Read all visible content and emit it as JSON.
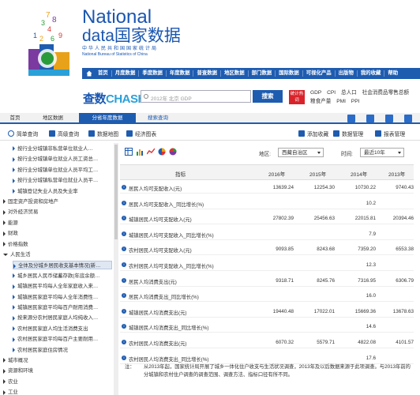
{
  "brand": {
    "line1": "National",
    "line2": "data国家数据",
    "line3": "中华人民共和国国家统计局",
    "line4": "National Bureau of Statistics of China"
  },
  "topnav": [
    "首页",
    "月度数据",
    "季度数据",
    "年度数据",
    "普查数据",
    "地区数据",
    "部门数据",
    "国际数据",
    "可视化产品",
    "出版物",
    "我的收藏",
    "帮助"
  ],
  "search": {
    "brand_main": "查数",
    "brand_sub": "CHASHU",
    "placeholder": "2012年 北京 GDP",
    "button": "搜索",
    "hot_badge": "统计热词",
    "hot_links": [
      "GDP",
      "CPI",
      "总人口",
      "社会消费品零售总额",
      "粮食产量",
      "PMI",
      "PPI"
    ]
  },
  "tabs": [
    "首页",
    "地区数据",
    "分省年度数据",
    "搜索查询"
  ],
  "toolbar": {
    "simple_query": "简单查询",
    "advanced_query": "高级查询",
    "data_map": "数据地图",
    "economic_chart": "经济图表",
    "add_favorite": "添加收藏",
    "data_manage": "数据管理",
    "report_manage": "报表管理"
  },
  "sidebar": [
    {
      "label": "按行业分城镇非私营单位就业人…",
      "level": 2,
      "arrow": "right"
    },
    {
      "label": "按行业分城镇单位就业人员工资总…",
      "level": 2,
      "arrow": "right"
    },
    {
      "label": "按行业分城镇单位就业人员平均工…",
      "level": 2,
      "arrow": "right"
    },
    {
      "label": "按行业分城镇私营单位就业人员平…",
      "level": 2,
      "arrow": "right"
    },
    {
      "label": "城镇登记失业人员及失业率",
      "level": 2,
      "arrow": "right"
    },
    {
      "label": "固定资产投资和房地产",
      "level": 1,
      "arrow": "right"
    },
    {
      "label": "对外经济贸易",
      "level": 1,
      "arrow": "right"
    },
    {
      "label": "能源",
      "level": 1,
      "arrow": "right"
    },
    {
      "label": "财政",
      "level": 1,
      "arrow": "right"
    },
    {
      "label": "价格指数",
      "level": 1,
      "arrow": "right"
    },
    {
      "label": "人民生活",
      "level": 1,
      "arrow": "down"
    },
    {
      "label": "全体及分城乡居民收支基本情况(新…",
      "level": 2,
      "arrow": "right",
      "selected": true
    },
    {
      "label": "城乡居民人民币储蓄存款(年底余额…",
      "level": 2,
      "arrow": "right"
    },
    {
      "label": "城镇居民平均每人全年家庭收入来…",
      "level": 2,
      "arrow": "right"
    },
    {
      "label": "城镇居民家庭平均每人全年消费性…",
      "level": 2,
      "arrow": "right"
    },
    {
      "label": "城镇居民家庭平均每百户耐用消费…",
      "level": 2,
      "arrow": "right"
    },
    {
      "label": "按来源分农村居民家庭人均纯收入…",
      "level": 2,
      "arrow": "right"
    },
    {
      "label": "农村居民家庭人均生活消费支出",
      "level": 2,
      "arrow": "right"
    },
    {
      "label": "农村居民家庭平均每百户主要耐用…",
      "level": 2,
      "arrow": "right"
    },
    {
      "label": "农村居民家庭住房情况",
      "level": 2,
      "arrow": "right"
    },
    {
      "label": "城市概况",
      "level": 1,
      "arrow": "right"
    },
    {
      "label": "资源和环境",
      "level": 1,
      "arrow": "right"
    },
    {
      "label": "农业",
      "level": 1,
      "arrow": "right"
    },
    {
      "label": "工业",
      "level": 1,
      "arrow": "right"
    }
  ],
  "controls": {
    "region_label": "地区:",
    "region_value": "西藏自治区",
    "time_label": "时间:",
    "time_value": "最近10年"
  },
  "table": {
    "header": [
      "指标",
      "2016年",
      "2015年",
      "2014年",
      "2013年"
    ],
    "rows": [
      {
        "label": "居民人均可支配收入(元)",
        "values": [
          "13639.24",
          "12254.30",
          "10730.22",
          "9740.43"
        ]
      },
      {
        "label": "居民人均可支配收入_同比增长(%)",
        "values": [
          "",
          "",
          "10.2",
          ""
        ]
      },
      {
        "label": "城镇居民人均可支配收入(元)",
        "values": [
          "27802.39",
          "25456.63",
          "22015.81",
          "20394.46"
        ]
      },
      {
        "label": "城镇居民人均可支配收入_同比增长(%)",
        "values": [
          "",
          "",
          "7.9",
          ""
        ]
      },
      {
        "label": "农村居民人均可支配收入(元)",
        "values": [
          "9093.85",
          "8243.68",
          "7359.20",
          "6553.38"
        ]
      },
      {
        "label": "农村居民人均可支配收入_同比增长(%)",
        "values": [
          "",
          "",
          "12.3",
          ""
        ]
      },
      {
        "label": "居民人均消费支出(元)",
        "values": [
          "9318.71",
          "8245.76",
          "7316.95",
          "6306.79"
        ]
      },
      {
        "label": "居民人均消费支出_同比增长(%)",
        "values": [
          "",
          "",
          "16.0",
          ""
        ]
      },
      {
        "label": "城镇居民人均消费支出(元)",
        "values": [
          "19440.48",
          "17022.01",
          "15669.36",
          "13678.63"
        ]
      },
      {
        "label": "城镇居民人均消费支出_同比增长(%)",
        "values": [
          "",
          "",
          "14.6",
          ""
        ]
      },
      {
        "label": "农村居民人均消费支出(元)",
        "values": [
          "6070.32",
          "5579.71",
          "4822.08",
          "4101.57"
        ]
      },
      {
        "label": "农村居民人均消费支出_同比增长(%)",
        "values": [
          "",
          "",
          "17.6",
          ""
        ]
      }
    ]
  },
  "note": {
    "key": "注：",
    "text": "从2013年起，国家统计局开展了城乡一体化住户收支与生活状况调查，2013年及以后数据来源于此项调查。与2013年前的分城镇和农村住户调查的调查范围、调查方法、指标口径有所不同。"
  },
  "colors": {
    "primary": "#1e5cb0",
    "accent_red": "#d8232a"
  }
}
